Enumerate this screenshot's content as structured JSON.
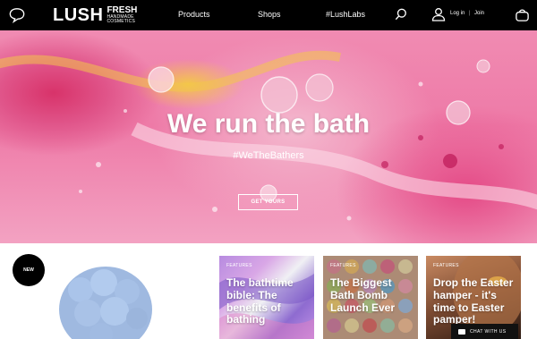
{
  "header": {
    "logo": {
      "main": "LUSH",
      "fresh": "FRESH",
      "line1": "HANDMADE",
      "line2": "COSMETICS"
    },
    "nav": [
      "Products",
      "Shops",
      "#LushLabs"
    ],
    "login": "Log in",
    "separator": "|",
    "join": "Join",
    "icons": {
      "chat": "chat-bubble-icon",
      "search": "search-icon",
      "user": "user-icon",
      "bag": "shopping-bag-icon"
    }
  },
  "hero": {
    "title": "We run the bath",
    "tag": "#WeTheBathers",
    "button": "GET YOURS"
  },
  "bottom": {
    "badge": "NEW",
    "cards": [
      {
        "label": "FEATURES",
        "title": "The bathtime bible: The benefits of bathing"
      },
      {
        "label": "FEATURES",
        "title": "The Biggest Bath Bomb Launch Ever"
      },
      {
        "label": "FEATURES",
        "title": "Drop the Easter hamper - it's time to Easter pamper!"
      }
    ],
    "chat": "CHAT WITH US"
  },
  "colors": {
    "header_bg": "#000000",
    "hero_pink": "#f08bb2",
    "accent_yellow": "#f3c64a"
  }
}
